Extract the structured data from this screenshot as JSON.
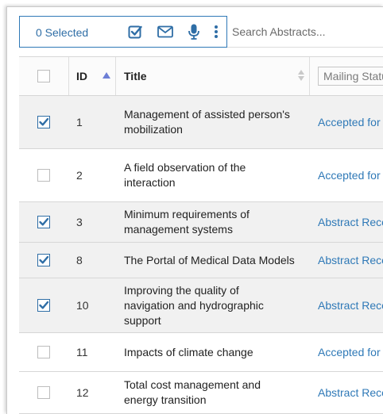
{
  "toolbar": {
    "selected_label": "0 Selected",
    "icons": [
      "check-square-icon",
      "envelope-icon",
      "microphone-icon",
      "more-vertical-icon"
    ],
    "search_placeholder": "Search Abstracts..."
  },
  "table": {
    "columns": {
      "id": "ID",
      "title": "Title",
      "status_filter_placeholder": "Mailing Status"
    },
    "rows": [
      {
        "checked": true,
        "id": "1",
        "title_lines": [
          "Management of assisted person's",
          "mobilization"
        ],
        "status": "Accepted for Presentation"
      },
      {
        "checked": false,
        "id": "2",
        "title_lines": [
          "A field observation of the",
          "interaction"
        ],
        "status": "Accepted for Presentation"
      },
      {
        "checked": true,
        "id": "3",
        "title_lines": [
          "Minimum requirements of",
          "management systems"
        ],
        "status": "Abstract Received"
      },
      {
        "checked": true,
        "id": "8",
        "title_lines": [
          "The Portal of Medical Data Models"
        ],
        "status": "Abstract Received"
      },
      {
        "checked": true,
        "id": "10",
        "title_lines": [
          "Improving the quality of",
          "navigation and hydrographic",
          "support"
        ],
        "status": "Abstract Received"
      },
      {
        "checked": false,
        "id": "11",
        "title_lines": [
          "Impacts of climate change"
        ],
        "status": "Accepted for Presentation"
      },
      {
        "checked": false,
        "id": "12",
        "title_lines": [
          "Total cost management and",
          "energy transition"
        ],
        "status": "Abstract Received"
      }
    ]
  },
  "colors": {
    "accent": "#2f79b7",
    "selected_row_bg": "#f1f1f1",
    "check_color": "#2f6ea6"
  }
}
